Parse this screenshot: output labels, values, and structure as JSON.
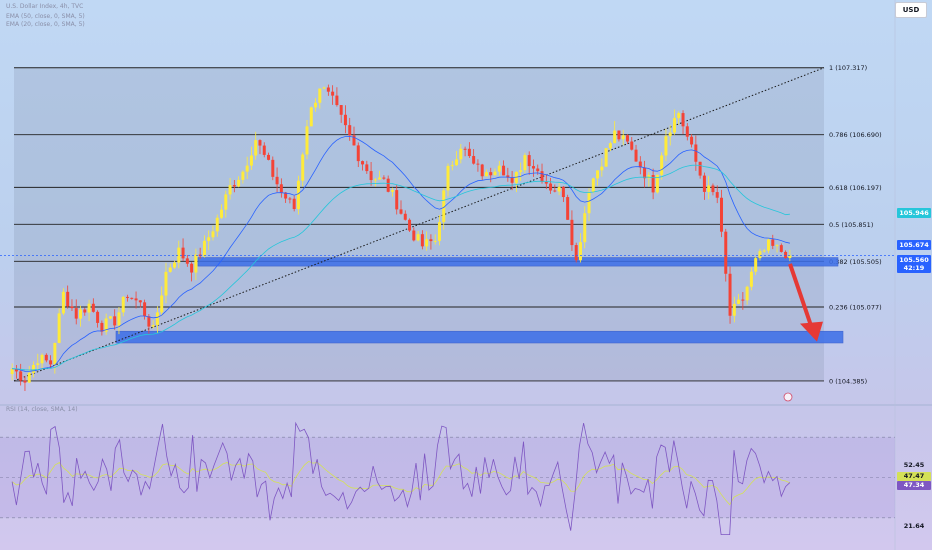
{
  "header": {
    "currency_label": "USD",
    "legend": [
      "U.S. Dollar Index, 4h, TVC",
      "EMA (50, close, 0, SMA, 5)",
      "EMA (20, close, 0, SMA, 5)"
    ]
  },
  "rsi_legend": "RSI (14, close, SMA, 14)",
  "price_tags": {
    "ema50": "105.946",
    "ema20": "105.674",
    "last": "105.560",
    "countdown": "42:19"
  },
  "rsi_tags": {
    "level_a": "52.45",
    "rsi": "47.47",
    "ma": "47.34",
    "low": "21.64"
  },
  "colors": {
    "up_candle": "#ffeb3b",
    "down_candle": "#f44336",
    "ema20": "#2962ff",
    "ema50": "#26c6da",
    "zone": "#3b6ee8",
    "arrow": "#e53935",
    "rsi_line": "#7e57c2",
    "rsi_ma": "#d4e157"
  },
  "chart_data": {
    "type": "candlestick",
    "instrument": "U.S. Dollar Index, 4h, TVC",
    "ylim": [
      104.15,
      107.53
    ],
    "fib_levels": [
      {
        "ratio": "1",
        "price": 107.317,
        "label": "1 (107.317)"
      },
      {
        "ratio": "0.786",
        "price": 106.69,
        "label": "0.786 (106.690)"
      },
      {
        "ratio": "0.618",
        "price": 106.197,
        "label": "0.618 (106.197)"
      },
      {
        "ratio": "0.5",
        "price": 105.851,
        "label": "0.5 (105.851)"
      },
      {
        "ratio": "0.382",
        "price": 105.505,
        "label": "0.382 (105.505)"
      },
      {
        "ratio": "0.236",
        "price": 105.077,
        "label": "0.236 (105.077)"
      },
      {
        "ratio": "0",
        "price": 104.385,
        "label": "0 (104.385)"
      }
    ],
    "zones": [
      {
        "from": 105.46,
        "to": 105.54
      },
      {
        "from": 104.74,
        "to": 104.85
      }
    ],
    "trendline": {
      "from_price": 104.385,
      "to_price": 107.317
    },
    "last_price": 105.56,
    "ema_50_last": 105.946,
    "ema_20_last": 105.674,
    "projection": {
      "from_price": 105.48,
      "to_price": 104.79
    },
    "close_path": [
      104.5,
      104.4,
      104.6,
      104.55,
      105.2,
      105.0,
      105.1,
      104.9,
      104.95,
      105.2,
      105.1,
      104.85,
      105.4,
      105.6,
      105.45,
      105.65,
      105.9,
      106.2,
      106.35,
      106.65,
      106.4,
      106.15,
      106.0,
      106.8,
      107.15,
      107.0,
      106.75,
      106.5,
      106.3,
      106.25,
      106.05,
      105.8,
      105.65,
      105.7,
      106.35,
      106.6,
      106.4,
      106.3,
      106.45,
      106.2,
      106.5,
      106.35,
      106.2,
      106.15,
      105.5,
      106.2,
      106.45,
      106.7,
      106.6,
      106.4,
      106.2,
      106.7,
      106.9,
      106.55,
      106.2,
      106.1,
      105.0,
      105.15,
      105.5,
      105.65,
      105.6,
      105.56
    ],
    "rsi": {
      "ylim": [
        15,
        85
      ],
      "levels": [
        70,
        50,
        30
      ],
      "last_rsi": 47.47,
      "last_ma": 47.34,
      "marked_values": [
        52.45,
        21.64
      ]
    }
  }
}
